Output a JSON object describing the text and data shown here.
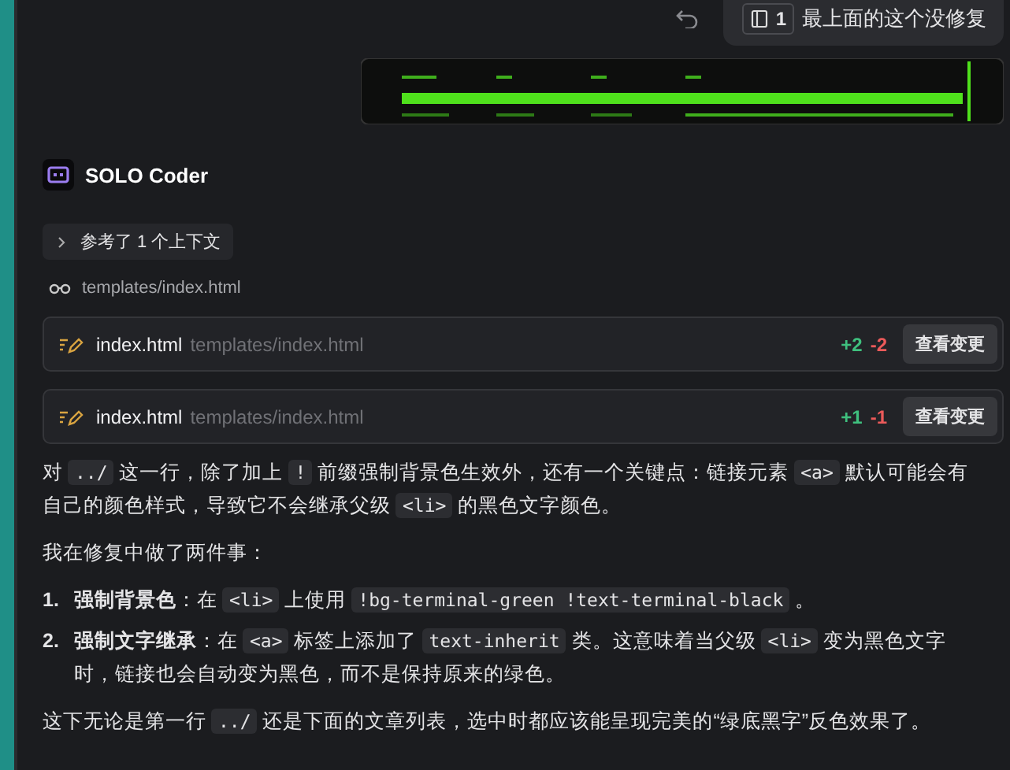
{
  "user_message": {
    "context_count": "1",
    "text": "最上面的这个没修复"
  },
  "agent": {
    "name": "SOLO Coder"
  },
  "context_toggle": {
    "label": "参考了 1 个上下文",
    "expanded": false
  },
  "viewed_file": "templates/index.html",
  "file_changes": [
    {
      "name": "index.html",
      "path": "templates/index.html",
      "added": "+2",
      "removed": "-2",
      "button": "查看变更"
    },
    {
      "name": "index.html",
      "path": "templates/index.html",
      "added": "+1",
      "removed": "-1",
      "button": "查看变更"
    }
  ],
  "blocks": [
    {
      "kind": "paragraph",
      "segments": [
        {
          "kind": "text",
          "text": "对 "
        },
        {
          "kind": "code",
          "text": "../"
        },
        {
          "kind": "text",
          "text": " 这一行，除了加上 "
        },
        {
          "kind": "code",
          "text": "!"
        },
        {
          "kind": "text",
          "text": " 前缀强制背景色生效外，还有一个关键点：链接元素 "
        },
        {
          "kind": "code",
          "text": "<a>"
        },
        {
          "kind": "text",
          "text": " 默认可能会有自己的颜色样式，导致它不会继承父级 "
        },
        {
          "kind": "code",
          "text": "<li>"
        },
        {
          "kind": "text",
          "text": " 的黑色文字颜色。"
        }
      ]
    },
    {
      "kind": "paragraph",
      "segments": [
        {
          "kind": "text",
          "text": "我在修复中做了两件事："
        }
      ]
    },
    {
      "kind": "list_item",
      "number": "1.",
      "segments": [
        {
          "kind": "bold",
          "text": "强制背景色"
        },
        {
          "kind": "text",
          "text": "：在 "
        },
        {
          "kind": "code",
          "text": "<li>"
        },
        {
          "kind": "text",
          "text": " 上使用 "
        },
        {
          "kind": "code",
          "text": "!bg-terminal-green !text-terminal-black"
        },
        {
          "kind": "text",
          "text": " 。"
        }
      ]
    },
    {
      "kind": "list_item",
      "number": "2.",
      "segments": [
        {
          "kind": "bold",
          "text": "强制文字继承"
        },
        {
          "kind": "text",
          "text": "：在 "
        },
        {
          "kind": "code",
          "text": "<a>"
        },
        {
          "kind": "text",
          "text": " 标签上添加了 "
        },
        {
          "kind": "code",
          "text": "text-inherit"
        },
        {
          "kind": "text",
          "text": " 类。这意味着当父级 "
        },
        {
          "kind": "code",
          "text": "<li>"
        },
        {
          "kind": "text",
          "text": " 变为黑色文字时，链接也会自动变为黑色，而不是保持原来的绿色。"
        }
      ]
    },
    {
      "kind": "paragraph",
      "segments": [
        {
          "kind": "text",
          "text": "这下无论是第一行 "
        },
        {
          "kind": "code",
          "text": "../"
        },
        {
          "kind": "text",
          "text": " 还是下面的文章列表，选中时都应该能呈现完美的“绿底黑字”反色效果了。"
        }
      ]
    }
  ]
}
